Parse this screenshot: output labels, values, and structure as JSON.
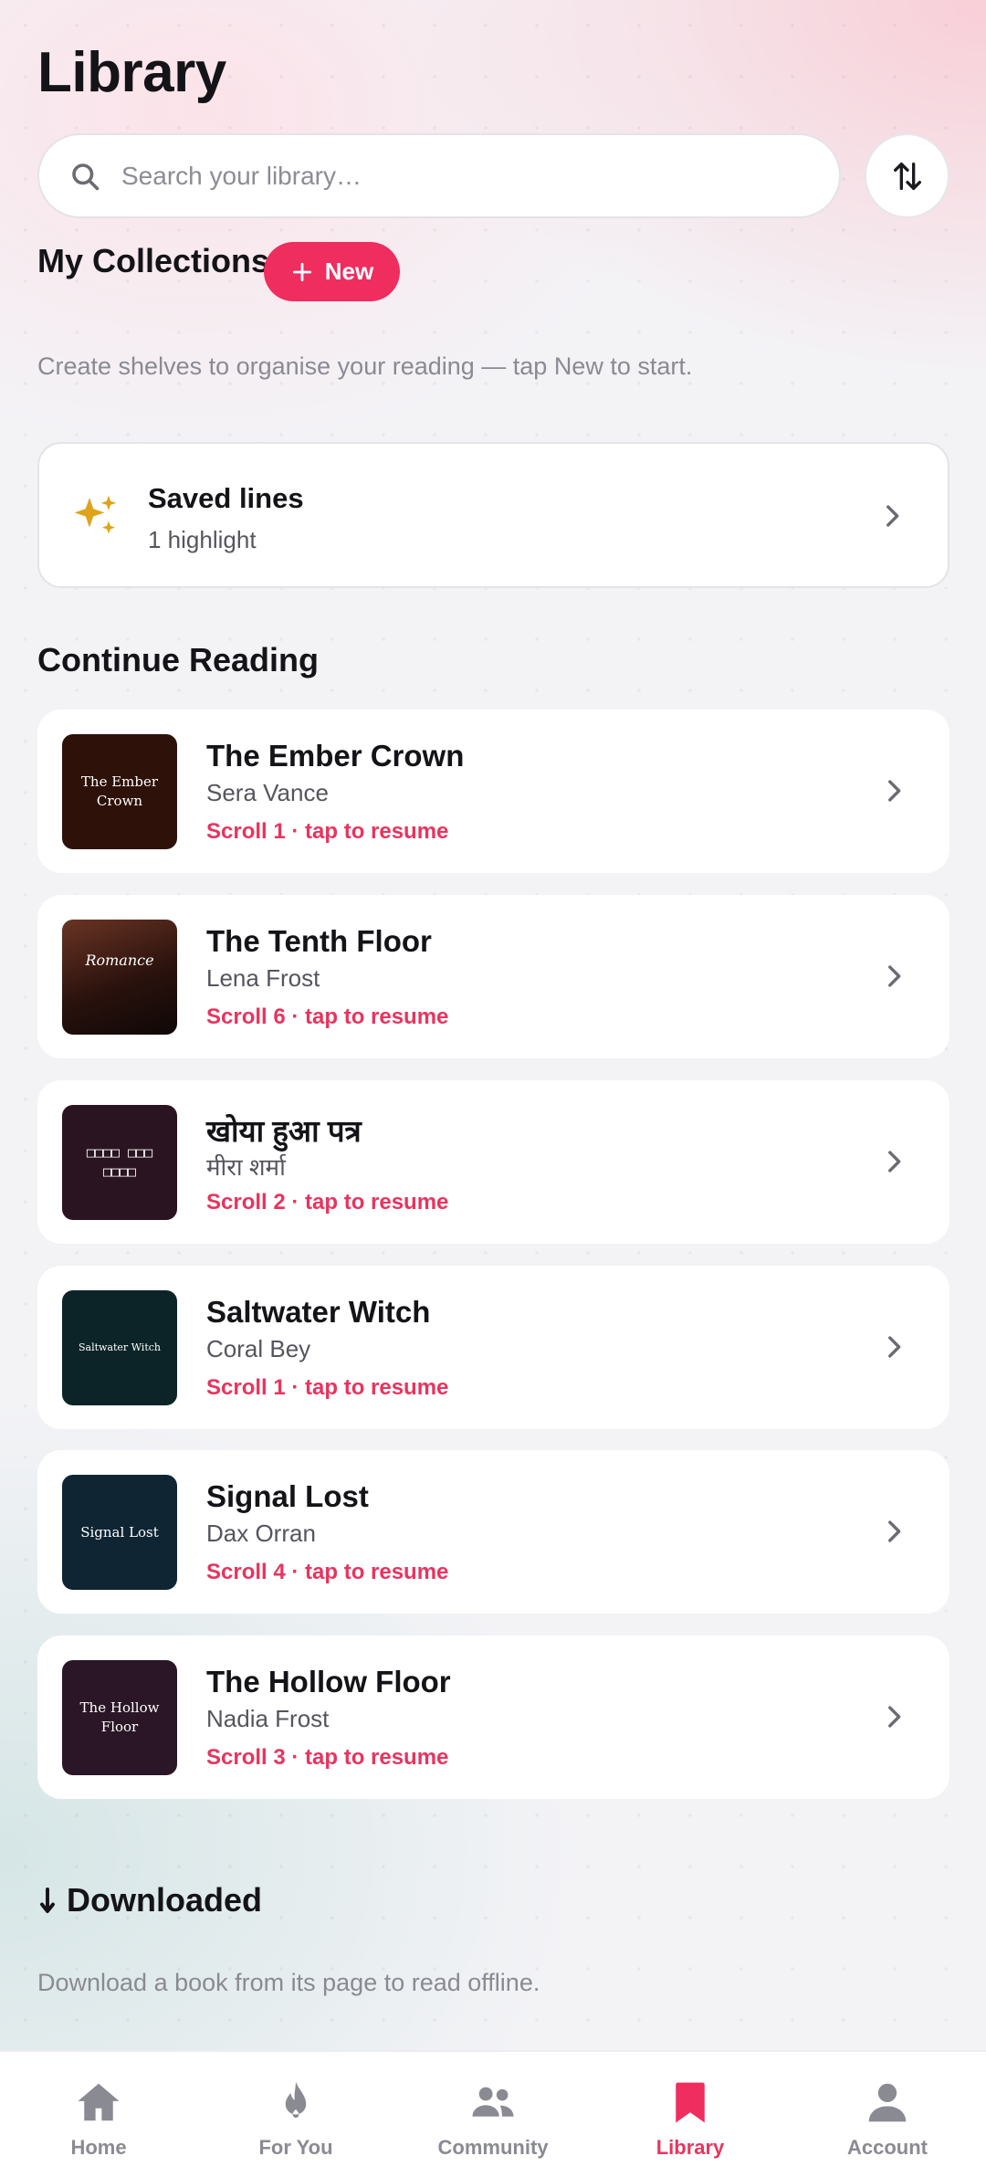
{
  "header": {
    "title": "Library"
  },
  "search": {
    "placeholder": "Search your library…"
  },
  "collections": {
    "title": "My Collections",
    "new_label": "New",
    "hint": "Create shelves to organise your reading — tap New to start."
  },
  "saved_lines": {
    "title": "Saved lines",
    "subtitle": "1 highlight"
  },
  "continue_reading": {
    "title": "Continue Reading",
    "books": [
      {
        "title": "The Ember Crown",
        "author": "Sera Vance",
        "progress": "Scroll 1 · tap to resume",
        "cover_text": "The Ember Crown",
        "cover_color": "#2e1209"
      },
      {
        "title": "The Tenth Floor",
        "author": "Lena Frost",
        "progress": "Scroll 6 · tap to resume",
        "cover_text": "Romance",
        "cover_color": "#1a0e0c"
      },
      {
        "title": "खोया हुआ पत्र",
        "author": "मीरा शर्मा",
        "progress": "Scroll 2 · tap to resume",
        "cover_text": "□□□□ □□□ □□□□",
        "cover_color": "#2b1421"
      },
      {
        "title": "Saltwater Witch",
        "author": "Coral Bey",
        "progress": "Scroll 1 · tap to resume",
        "cover_text": "Saltwater Witch",
        "cover_color": "#0c2427"
      },
      {
        "title": "Signal Lost",
        "author": "Dax Orran",
        "progress": "Scroll 4 · tap to resume",
        "cover_text": "Signal Lost",
        "cover_color": "#0f2533"
      },
      {
        "title": "The Hollow Floor",
        "author": "Nadia Frost",
        "progress": "Scroll 3 · tap to resume",
        "cover_text": "The Hollow Floor",
        "cover_color": "#2a1626"
      }
    ]
  },
  "downloaded": {
    "title": "Downloaded",
    "hint": "Download a book from its page to read offline."
  },
  "nav": {
    "items": [
      {
        "label": "Home",
        "icon": "home-icon"
      },
      {
        "label": "For You",
        "icon": "flame-icon"
      },
      {
        "label": "Community",
        "icon": "people-icon"
      },
      {
        "label": "Library",
        "icon": "bookmark-icon",
        "active": true
      },
      {
        "label": "Account",
        "icon": "person-icon"
      }
    ]
  },
  "colors": {
    "accent": "#ef2d5e",
    "muted": "#8a8a93",
    "saved_icon": "#e0a21a"
  }
}
